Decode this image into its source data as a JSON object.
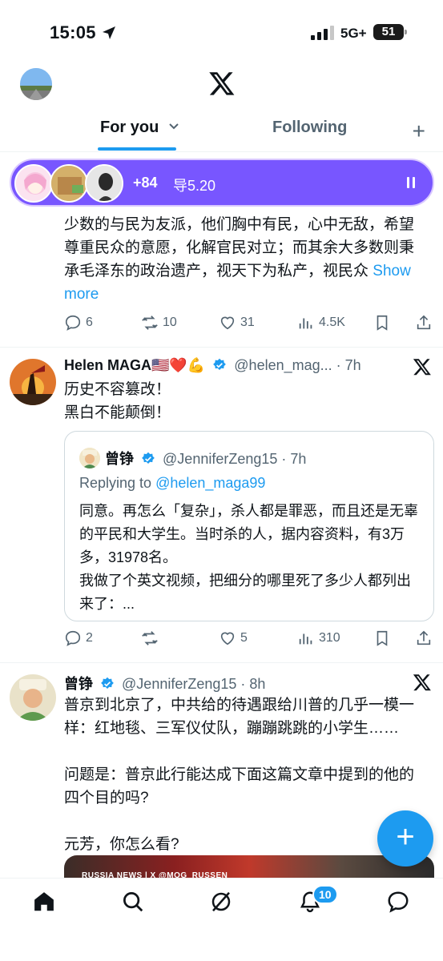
{
  "status_bar": {
    "time": "15:05",
    "network": "5G+",
    "battery": "51"
  },
  "header": {
    "tabs": [
      {
        "label": "For you"
      },
      {
        "label": "Following"
      }
    ]
  },
  "spaces": {
    "listeners": "+84",
    "title": "导5.20"
  },
  "tweets": [
    {
      "text": "少数的与民为友派，他们胸中有民，心中无敌，希望尊重民众的意愿，化解官民对立；而其余大多数则秉承毛泽东的政治遗产，视天下为私产，视民众",
      "show_more": "Show more",
      "stats": {
        "replies": "6",
        "reposts": "10",
        "likes": "31",
        "views": "4.5K"
      }
    },
    {
      "name": "Helen MAGA🇺🇸❤️💪",
      "handle": "@helen_mag...",
      "time": "· 7h",
      "text_lines": [
        "历史不容篡改！",
        "黑白不能颠倒！"
      ],
      "quote": {
        "name": "曾铮",
        "handle": "@JenniferZeng15",
        "time": "· 7h",
        "replying_prefix": "Replying to ",
        "replying_handle": "@helen_maga99",
        "text_lines": [
          "同意。再怎么「复杂」，杀人都是罪恶，而且还是无辜的平民和大学生。当时杀的人，据内容资料，有3万多，31978名。",
          "我做了个英文视频，把细分的哪里死了多少人都列出来了：..."
        ]
      },
      "stats": {
        "replies": "2",
        "reposts": "",
        "likes": "5",
        "views": "310"
      }
    },
    {
      "name": "曾铮",
      "handle": "@JenniferZeng15",
      "time": "· 8h",
      "paragraphs": [
        "普京到北京了，中共给的待遇跟给川普的几乎一模一样：红地毯、三军仪仗队，蹦蹦跳跳的小学生……",
        "问题是：普京此行能达成下面这篇文章中提到的他的四个目的吗?",
        "元芳，你怎么看?"
      ],
      "media_caption": "RUSSIA NEWS | X @MOG_RUSSEN"
    }
  ],
  "fab": {
    "label": "+"
  },
  "bottom_nav": {
    "notifications_badge": "10"
  },
  "colors": {
    "accent": "#1d9bf0",
    "spaces": "#7856ff",
    "text": "#0f1419",
    "muted": "#536471"
  }
}
